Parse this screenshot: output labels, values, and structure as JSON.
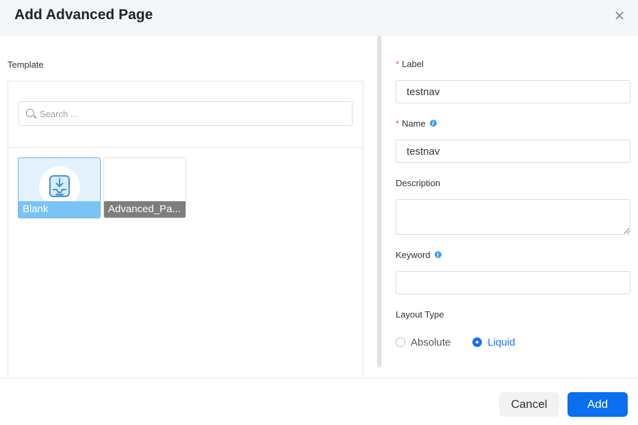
{
  "dialog": {
    "title": "Add Advanced Page",
    "close_icon": "close-icon"
  },
  "template": {
    "label": "Template",
    "search_placeholder": "Search ...",
    "cards": [
      {
        "name": "Blank",
        "selected": true
      },
      {
        "name": "Advanced_Pa..."
      }
    ]
  },
  "form": {
    "label": {
      "required_mark": "*",
      "text": "Label",
      "value": "testnav"
    },
    "name": {
      "required_mark": "*",
      "text": "Name",
      "value": "testnav"
    },
    "description": {
      "text": "Description",
      "value": ""
    },
    "keyword": {
      "text": "Keyword",
      "value": ""
    },
    "layout_type": {
      "text": "Layout Type",
      "options": [
        {
          "label": "Absolute",
          "checked": false
        },
        {
          "label": "Liquid",
          "checked": true
        }
      ]
    },
    "info_glyph": "i"
  },
  "footer": {
    "cancel": "Cancel",
    "add": "Add"
  },
  "colors": {
    "accent": "#0b6ff0",
    "required": "#e34d59",
    "blank_card": "#7cc3f5"
  }
}
